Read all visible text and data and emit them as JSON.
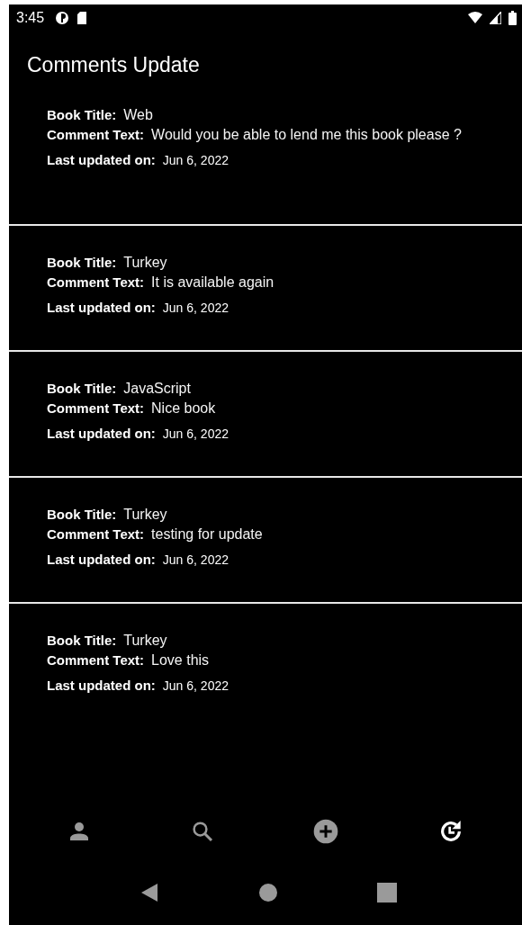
{
  "status_bar": {
    "time": "3:45"
  },
  "title": "Comments Update",
  "comments": [
    {
      "fields": [
        {
          "kind": "text",
          "label": "Book Title:",
          "value": "Web"
        },
        {
          "kind": "text",
          "label": "Comment Text:",
          "value": "Would you be able to lend me this book please ?"
        },
        {
          "kind": "date",
          "label": "Last updated on:",
          "value": "Jun 6, 2022"
        }
      ]
    },
    {
      "fields": [
        {
          "kind": "text",
          "label": "Book Title:",
          "value": "Turkey"
        },
        {
          "kind": "text",
          "label": "Comment Text:",
          "value": "It is available again"
        },
        {
          "kind": "date",
          "label": "Last updated on:",
          "value": "Jun 6, 2022"
        }
      ]
    },
    {
      "fields": [
        {
          "kind": "text",
          "label": "Book Title:",
          "value": "JavaScript"
        },
        {
          "kind": "text",
          "label": "Comment Text:",
          "value": "Nice book"
        },
        {
          "kind": "date",
          "label": "Last updated on:",
          "value": "Jun 6, 2022"
        }
      ]
    },
    {
      "fields": [
        {
          "kind": "text",
          "label": "Book Title:",
          "value": "Turkey"
        },
        {
          "kind": "text",
          "label": "Comment Text:",
          "value": "testing for update"
        },
        {
          "kind": "date",
          "label": "Last updated on:",
          "value": "Jun 6, 2022"
        }
      ]
    },
    {
      "fields": [
        {
          "kind": "text",
          "label": "Book Title:",
          "value": "Turkey"
        },
        {
          "kind": "text",
          "label": "Comment Text:",
          "value": "Love this"
        },
        {
          "kind": "date",
          "label": "Last updated on:",
          "value": "Jun 6, 2022"
        }
      ]
    }
  ],
  "bottom_nav": [
    {
      "kind": "profile",
      "selected": false
    },
    {
      "kind": "search",
      "selected": false
    },
    {
      "kind": "add",
      "selected": false
    },
    {
      "kind": "history",
      "selected": true
    }
  ]
}
